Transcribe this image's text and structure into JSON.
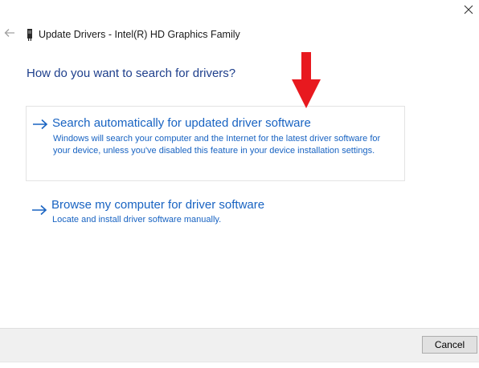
{
  "window": {
    "title": "Update Drivers - Intel(R) HD Graphics Family",
    "close_icon": "close-icon",
    "back_icon": "back-arrow-icon",
    "device_icon": "display-adapter-icon"
  },
  "main": {
    "question": "How do you want to search for drivers?",
    "options": [
      {
        "title": "Search automatically for updated driver software",
        "description": "Windows will search your computer and the Internet for the latest driver software for your device, unless you've disabled this feature in your device installation settings.",
        "icon": "right-arrow-icon"
      },
      {
        "title": "Browse my computer for driver software",
        "description": "Locate and install driver software manually.",
        "icon": "right-arrow-icon"
      }
    ]
  },
  "annotation": {
    "icon": "red-down-arrow-icon",
    "color": "#e8191f"
  },
  "footer": {
    "cancel_label": "Cancel"
  },
  "colors": {
    "link_blue": "#1863c2",
    "heading_blue": "#1e3f8c",
    "footer_bg": "#f0f0f0"
  }
}
